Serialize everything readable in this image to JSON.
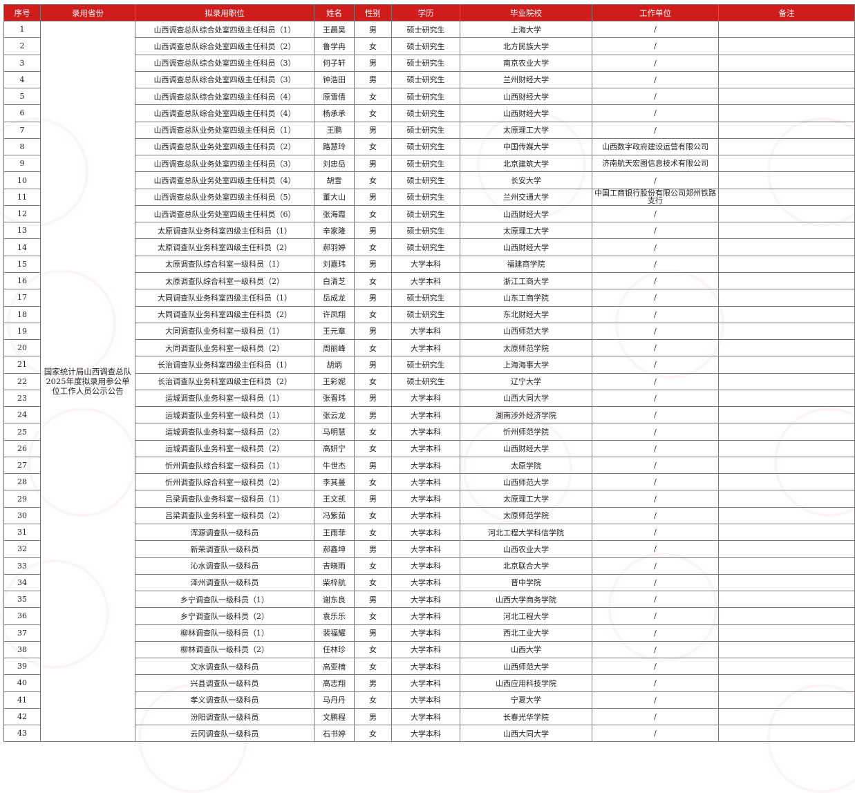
{
  "headers": [
    "序号",
    "录用省份",
    "拟录用职位",
    "姓名",
    "性别",
    "学历",
    "毕业院校",
    "工作单位",
    "备注"
  ],
  "province": "国家统计局山西调查总队2025年度拟录用参公单位工作人员公示公告",
  "rows": [
    [
      "1",
      "山西调查总队综合处室四级主任科员（1）",
      "王晨昊",
      "男",
      "硕士研究生",
      "上海大学",
      "/",
      ""
    ],
    [
      "2",
      "山西调查总队综合处室四级主任科员（2）",
      "鲁学冉",
      "女",
      "硕士研究生",
      "北方民族大学",
      "/",
      ""
    ],
    [
      "3",
      "山西调查总队综合处室四级主任科员（3）",
      "何子轩",
      "男",
      "硕士研究生",
      "南京农业大学",
      "/",
      ""
    ],
    [
      "4",
      "山西调查总队综合处室四级主任科员（3）",
      "钟浩田",
      "男",
      "硕士研究生",
      "兰州财经大学",
      "/",
      ""
    ],
    [
      "5",
      "山西调查总队综合处室四级主任科员（4）",
      "原雪倩",
      "女",
      "硕士研究生",
      "山西财经大学",
      "/",
      ""
    ],
    [
      "6",
      "山西调查总队综合处室四级主任科员（4）",
      "杨承承",
      "女",
      "硕士研究生",
      "山西财经大学",
      "/",
      ""
    ],
    [
      "7",
      "山西调查总队业务处室四级主任科员（1）",
      "王鹏",
      "男",
      "硕士研究生",
      "太原理工大学",
      "/",
      ""
    ],
    [
      "8",
      "山西调查总队业务处室四级主任科员（2）",
      "路慧玲",
      "女",
      "硕士研究生",
      "中国传媒大学",
      "山西数字政府建设运营有限公司",
      ""
    ],
    [
      "9",
      "山西调查总队业务处室四级主任科员（3）",
      "刘忠岳",
      "男",
      "硕士研究生",
      "北京建筑大学",
      "济南航天宏图信息技术有限公司",
      ""
    ],
    [
      "10",
      "山西调查总队业务处室四级主任科员（4）",
      "胡雪",
      "女",
      "硕士研究生",
      "长安大学",
      "/",
      ""
    ],
    [
      "11",
      "山西调查总队业务处室四级主任科员（5）",
      "董大山",
      "男",
      "硕士研究生",
      "兰州交通大学",
      "中国工商银行股份有限公司郑州铁路支行",
      ""
    ],
    [
      "12",
      "山西调查总队业务处室四级主任科员（6）",
      "张海霞",
      "女",
      "硕士研究生",
      "山西财经大学",
      "/",
      ""
    ],
    [
      "13",
      "太原调查队业务科室四级主任科员（1）",
      "辛家隆",
      "男",
      "硕士研究生",
      "太原理工大学",
      "/",
      ""
    ],
    [
      "14",
      "太原调查队业务科室四级主任科员（2）",
      "郝羽婷",
      "女",
      "硕士研究生",
      "山西财经大学",
      "/",
      ""
    ],
    [
      "15",
      "太原调查队综合科室一级科员（1）",
      "刘嘉玮",
      "男",
      "大学本科",
      "福建商学院",
      "/",
      ""
    ],
    [
      "16",
      "太原调查队综合科室一级科员（2）",
      "白清芝",
      "女",
      "大学本科",
      "浙江工商大学",
      "/",
      ""
    ],
    [
      "17",
      "大同调查队业务科室四级主任科员（1）",
      "岳成龙",
      "男",
      "硕士研究生",
      "山东工商学院",
      "/",
      ""
    ],
    [
      "18",
      "大同调查队业务科室四级主任科员（2）",
      "许凤翔",
      "女",
      "硕士研究生",
      "东北财经大学",
      "/",
      ""
    ],
    [
      "19",
      "大同调查队业务科室一级科员（1）",
      "王元章",
      "男",
      "大学本科",
      "山西师范大学",
      "/",
      ""
    ],
    [
      "20",
      "大同调查队业务科室一级科员（2）",
      "周丽峰",
      "女",
      "大学本科",
      "太原师范学院",
      "/",
      ""
    ],
    [
      "21",
      "长治调查队业务科室四级主任科员（1）",
      "胡炳",
      "男",
      "硕士研究生",
      "上海海事大学",
      "/",
      ""
    ],
    [
      "22",
      "长治调查队业务科室四级主任科员（2）",
      "王彩妮",
      "女",
      "硕士研究生",
      "辽宁大学",
      "/",
      ""
    ],
    [
      "23",
      "运城调查队业务科室一级科员（1）",
      "张晋玮",
      "男",
      "大学本科",
      "山西大同大学",
      "/",
      ""
    ],
    [
      "24",
      "运城调查队业务科室一级科员（1）",
      "张云龙",
      "男",
      "大学本科",
      "湖南涉外经济学院",
      "/",
      ""
    ],
    [
      "25",
      "运城调查队业务科室一级科员（2）",
      "马明慧",
      "女",
      "大学本科",
      "忻州师范学院",
      "/",
      ""
    ],
    [
      "26",
      "运城调查队业务科室一级科员（2）",
      "高妍宁",
      "女",
      "大学本科",
      "山西财经大学",
      "/",
      ""
    ],
    [
      "27",
      "忻州调查队综合科室一级科员（1）",
      "牛世杰",
      "男",
      "大学本科",
      "太原学院",
      "/",
      ""
    ],
    [
      "28",
      "忻州调查队综合科室一级科员（2）",
      "李其蔓",
      "女",
      "大学本科",
      "山西师范大学",
      "/",
      ""
    ],
    [
      "29",
      "吕梁调查队业务科室一级科员（1）",
      "王文凯",
      "男",
      "大学本科",
      "太原理工大学",
      "/",
      ""
    ],
    [
      "30",
      "吕梁调查队业务科室一级科员（2）",
      "冯紫茹",
      "女",
      "大学本科",
      "太原师范学院",
      "/",
      ""
    ],
    [
      "31",
      "浑源调查队一级科员",
      "王雨菲",
      "女",
      "大学本科",
      "河北工程大学科信学院",
      "/",
      ""
    ],
    [
      "32",
      "新荣调查队一级科员",
      "郝鑫坤",
      "男",
      "大学本科",
      "山西农业大学",
      "/",
      ""
    ],
    [
      "33",
      "沁水调查队一级科员",
      "吉晓雨",
      "女",
      "大学本科",
      "北京联合大学",
      "/",
      ""
    ],
    [
      "34",
      "泽州调查队一级科员",
      "柴梓航",
      "女",
      "大学本科",
      "晋中学院",
      "/",
      ""
    ],
    [
      "35",
      "乡宁调查队一级科员（1）",
      "谢东良",
      "男",
      "大学本科",
      "山西大学商务学院",
      "/",
      ""
    ],
    [
      "36",
      "乡宁调查队一级科员（2）",
      "袁乐乐",
      "女",
      "大学本科",
      "河北工程大学",
      "/",
      ""
    ],
    [
      "37",
      "柳林调查队一级科员（1）",
      "裴福耀",
      "男",
      "大学本科",
      "西北工业大学",
      "/",
      ""
    ],
    [
      "38",
      "柳林调查队一级科员（2）",
      "任林珍",
      "女",
      "大学本科",
      "山西大学",
      "/",
      ""
    ],
    [
      "39",
      "文水调查队一级科员",
      "高亚楠",
      "女",
      "大学本科",
      "山西师范大学",
      "/",
      ""
    ],
    [
      "40",
      "兴县调查队一级科员",
      "高志翔",
      "男",
      "大学本科",
      "山西应用科技学院",
      "/",
      ""
    ],
    [
      "41",
      "孝义调查队一级科员",
      "马丹丹",
      "女",
      "大学本科",
      "宁夏大学",
      "/",
      ""
    ],
    [
      "42",
      "汾阳调查队一级科员",
      "文鹏程",
      "男",
      "大学本科",
      "长春光华学院",
      "/",
      ""
    ],
    [
      "43",
      "云冈调查队一级科员",
      "石书婷",
      "女",
      "大学本科",
      "山西大同大学",
      "/",
      ""
    ]
  ]
}
